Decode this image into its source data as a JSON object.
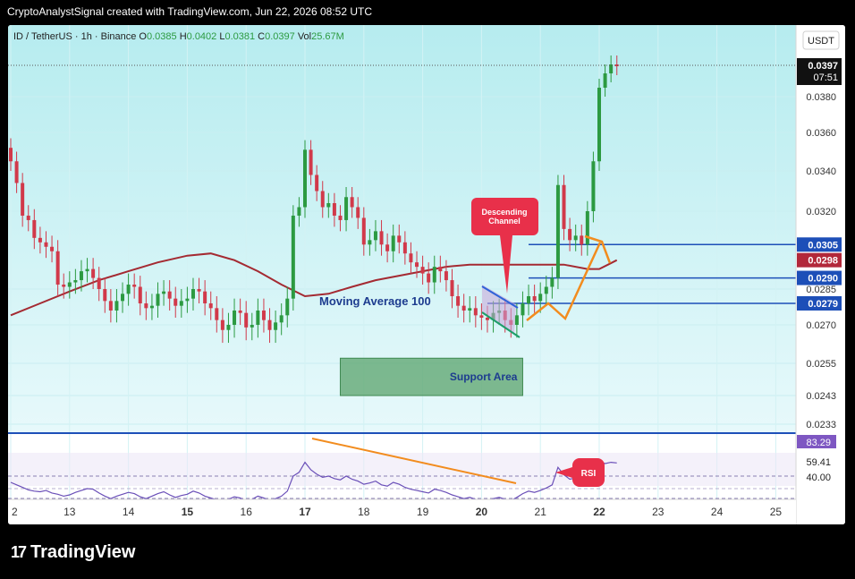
{
  "header": {
    "text": "CryptoAnalystSignal created with TradingView.com, Jun 22, 2026 08:52 UTC"
  },
  "footer": {
    "brand": "TradingView",
    "logo_icon": "tradingview-logo-icon"
  },
  "chart_data": {
    "type": "candlestick",
    "symbol_line": {
      "symbol": "ID / TetherUS · 1h · Binance",
      "open_label": "O",
      "open": "0.0385",
      "high_label": "H",
      "high": "0.0402",
      "low_label": "L",
      "low": "0.0381",
      "close_label": "C",
      "close": "0.0397",
      "vol_label": "Vol",
      "vol": "25.67M"
    },
    "currency_button": "USDT",
    "last_price": {
      "value": "0.0397",
      "countdown": "07:51"
    },
    "y_ticks": [
      "0.0380",
      "0.0360",
      "0.0340",
      "0.0320",
      "0.0285",
      "0.0270",
      "0.0255",
      "0.0243",
      "0.0233"
    ],
    "x_ticks": [
      {
        "label": "2",
        "bold": false
      },
      {
        "label": "13",
        "bold": false
      },
      {
        "label": "14",
        "bold": false
      },
      {
        "label": "15",
        "bold": true
      },
      {
        "label": "16",
        "bold": false
      },
      {
        "label": "17",
        "bold": true
      },
      {
        "label": "18",
        "bold": false
      },
      {
        "label": "19",
        "bold": false
      },
      {
        "label": "20",
        "bold": true
      },
      {
        "label": "21",
        "bold": false
      },
      {
        "label": "22",
        "bold": true
      },
      {
        "label": "23",
        "bold": false
      },
      {
        "label": "24",
        "bold": false
      },
      {
        "label": "25",
        "bold": false
      }
    ],
    "levels": [
      {
        "value": 0.0305,
        "label": "0.0305",
        "color": "#1d4fb8",
        "start_day": 20.8
      },
      {
        "value": 0.0298,
        "label": "0.0298",
        "color": "#b2283a",
        "start_day": null
      },
      {
        "value": 0.029,
        "label": "0.0290",
        "color": "#1d4fb8",
        "start_day": 20.8
      },
      {
        "value": 0.0279,
        "label": "0.0279",
        "color": "#1d4fb8",
        "start_day": 20.1
      }
    ],
    "moving_average": {
      "label": "Moving Average 100",
      "color": "#a42a32",
      "points": [
        [
          12.0,
          0.0274
        ],
        [
          12.5,
          0.0279
        ],
        [
          13.0,
          0.0284
        ],
        [
          13.5,
          0.0289
        ],
        [
          14.0,
          0.0293
        ],
        [
          14.5,
          0.0297
        ],
        [
          15.0,
          0.03
        ],
        [
          15.4,
          0.0301
        ],
        [
          15.8,
          0.0298
        ],
        [
          16.2,
          0.0293
        ],
        [
          16.6,
          0.0287
        ],
        [
          17.0,
          0.0282
        ],
        [
          17.4,
          0.0283
        ],
        [
          17.8,
          0.0286
        ],
        [
          18.2,
          0.0289
        ],
        [
          18.6,
          0.0291
        ],
        [
          19.0,
          0.0293
        ],
        [
          19.4,
          0.0295
        ],
        [
          19.8,
          0.0296
        ],
        [
          20.2,
          0.0296
        ],
        [
          20.6,
          0.0296
        ],
        [
          21.0,
          0.0296
        ],
        [
          21.4,
          0.0296
        ],
        [
          21.8,
          0.0294
        ],
        [
          22.0,
          0.0294
        ],
        [
          22.15,
          0.0296
        ],
        [
          22.3,
          0.0298
        ]
      ]
    },
    "candles": [
      {
        "x": [
          12.0,
          12.1,
          12.2,
          12.3,
          12.4,
          12.5,
          12.6,
          12.7,
          12.8,
          12.9,
          13.0,
          13.1,
          13.2,
          13.3,
          13.4,
          13.5,
          13.6,
          13.7,
          13.8,
          13.9,
          14.0,
          14.1,
          14.2,
          14.3,
          14.4,
          14.5,
          14.6,
          14.7,
          14.8,
          14.9,
          15.0,
          15.1,
          15.2,
          15.3,
          15.4,
          15.5,
          15.6,
          15.7,
          15.8,
          15.9,
          16.0,
          16.1,
          16.2,
          16.3,
          16.4,
          16.5,
          16.6,
          16.7,
          16.8,
          16.9,
          17.0,
          17.1,
          17.2,
          17.3,
          17.4,
          17.5,
          17.6,
          17.7,
          17.8,
          17.9,
          18.0,
          18.1,
          18.2,
          18.3,
          18.4,
          18.5,
          18.6,
          18.7,
          18.8,
          18.9,
          19.0,
          19.1,
          19.2,
          19.3,
          19.4,
          19.5,
          19.6,
          19.7,
          19.8,
          19.9,
          20.0,
          20.1,
          20.2,
          20.3,
          20.4,
          20.5,
          20.6,
          20.7,
          20.8,
          20.9,
          21.0,
          21.1,
          21.2,
          21.3,
          21.4,
          21.5,
          21.6,
          21.7,
          21.8,
          21.9,
          22.0,
          22.1,
          22.2,
          22.3
        ]
      },
      {
        "close": [
          0.0345,
          0.0334,
          0.0318,
          0.0316,
          0.0308,
          0.0306,
          0.0304,
          0.0302,
          0.0287,
          0.0286,
          0.0288,
          0.0289,
          0.0293,
          0.0294,
          0.029,
          0.0285,
          0.028,
          0.0276,
          0.028,
          0.0283,
          0.0287,
          0.0286,
          0.0279,
          0.0277,
          0.0278,
          0.0283,
          0.0284,
          0.0281,
          0.0278,
          0.028,
          0.0281,
          0.0285,
          0.0284,
          0.0279,
          0.0277,
          0.0272,
          0.0268,
          0.027,
          0.0276,
          0.0275,
          0.0269,
          0.027,
          0.0276,
          0.0272,
          0.0268,
          0.0271,
          0.0274,
          0.0281,
          0.0318,
          0.0322,
          0.0351,
          0.0338,
          0.033,
          0.0322,
          0.0324,
          0.0318,
          0.0316,
          0.0327,
          0.0322,
          0.0317,
          0.0305,
          0.0307,
          0.0311,
          0.0305,
          0.0302,
          0.0309,
          0.0306,
          0.0301,
          0.0297,
          0.0295,
          0.0292,
          0.0288,
          0.0295,
          0.0293,
          0.0289,
          0.0282,
          0.0278,
          0.0276,
          0.0277,
          0.0274,
          0.0273,
          0.0272,
          0.0275,
          0.0276,
          0.0272,
          0.027,
          0.0274,
          0.0279,
          0.0282,
          0.028,
          0.0283,
          0.0286,
          0.029,
          0.0333,
          0.0312,
          0.0307,
          0.0309,
          0.0305,
          0.032,
          0.0345,
          0.0385,
          0.0393,
          0.0398,
          0.0397
        ]
      },
      {
        "open": [
          0.0352,
          0.0345,
          0.0334,
          0.0318,
          0.0316,
          0.0308,
          0.0306,
          0.0304,
          0.0302,
          0.0287,
          0.0286,
          0.0288,
          0.0289,
          0.0293,
          0.0294,
          0.029,
          0.0285,
          0.028,
          0.0276,
          0.028,
          0.0283,
          0.0287,
          0.0286,
          0.0279,
          0.0277,
          0.0278,
          0.0283,
          0.0284,
          0.0281,
          0.0278,
          0.028,
          0.0281,
          0.0285,
          0.0284,
          0.0279,
          0.0277,
          0.0272,
          0.0268,
          0.027,
          0.0276,
          0.0275,
          0.0269,
          0.027,
          0.0276,
          0.0272,
          0.0268,
          0.0271,
          0.0274,
          0.0281,
          0.0318,
          0.0322,
          0.0351,
          0.0338,
          0.033,
          0.0322,
          0.0324,
          0.0318,
          0.0316,
          0.0327,
          0.0322,
          0.0317,
          0.0305,
          0.0307,
          0.0311,
          0.0305,
          0.0302,
          0.0309,
          0.0306,
          0.0301,
          0.0297,
          0.0295,
          0.0292,
          0.0288,
          0.0295,
          0.0293,
          0.0289,
          0.0282,
          0.0278,
          0.0276,
          0.0277,
          0.0274,
          0.0273,
          0.0272,
          0.0275,
          0.0276,
          0.0272,
          0.027,
          0.0274,
          0.0279,
          0.0282,
          0.028,
          0.0283,
          0.0286,
          0.029,
          0.0333,
          0.0312,
          0.0307,
          0.0309,
          0.0305,
          0.032,
          0.0345,
          0.0385,
          0.0393,
          0.0398
        ]
      }
    ],
    "annotations": {
      "descending_channel": {
        "text": "Descending Channel",
        "color": "#e8304a"
      },
      "support_area": {
        "text": "Support Area",
        "low": 0.0243,
        "high": 0.0257,
        "from_day": 17.6,
        "to_day": 20.7
      },
      "rsi_badge": {
        "text": "RSI",
        "color": "#e8304a"
      }
    },
    "rsi": {
      "values": [
        "83.29",
        "59.41",
        "40.00"
      ],
      "top_color": "#7e57c2",
      "series": [
        60,
        56,
        52,
        48,
        46,
        45,
        47,
        43,
        41,
        38,
        40,
        44,
        47,
        50,
        49,
        43,
        38,
        34,
        38,
        41,
        44,
        42,
        37,
        34,
        38,
        42,
        45,
        40,
        36,
        39,
        41,
        46,
        43,
        38,
        35,
        32,
        30,
        33,
        37,
        35,
        30,
        33,
        38,
        35,
        31,
        34,
        38,
        46,
        70,
        76,
        92,
        80,
        73,
        68,
        70,
        66,
        64,
        70,
        65,
        62,
        57,
        59,
        62,
        56,
        54,
        60,
        57,
        52,
        49,
        47,
        45,
        43,
        49,
        47,
        44,
        40,
        37,
        34,
        36,
        33,
        31,
        30,
        34,
        36,
        33,
        31,
        36,
        42,
        46,
        44,
        47,
        51,
        56,
        84,
        72,
        65,
        67,
        63,
        74,
        86,
        93,
        90,
        92,
        91
      ]
    }
  }
}
